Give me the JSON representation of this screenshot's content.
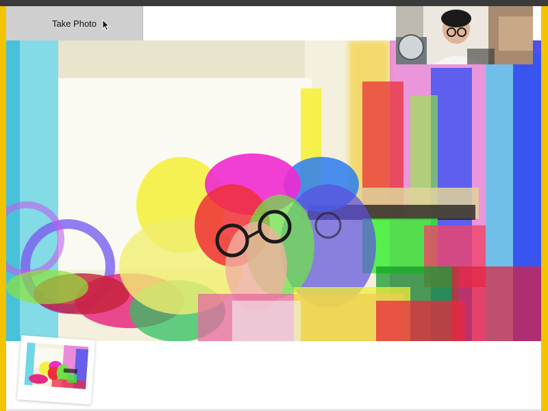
{
  "toolbar": {
    "take_photo_label": "Take Photo"
  },
  "icons": {
    "cursor": "cursor-icon"
  },
  "colors": {
    "frame_accent": "#f3c300",
    "topbar": "#3a3a3a",
    "button_bg": "#cfcfcf"
  }
}
